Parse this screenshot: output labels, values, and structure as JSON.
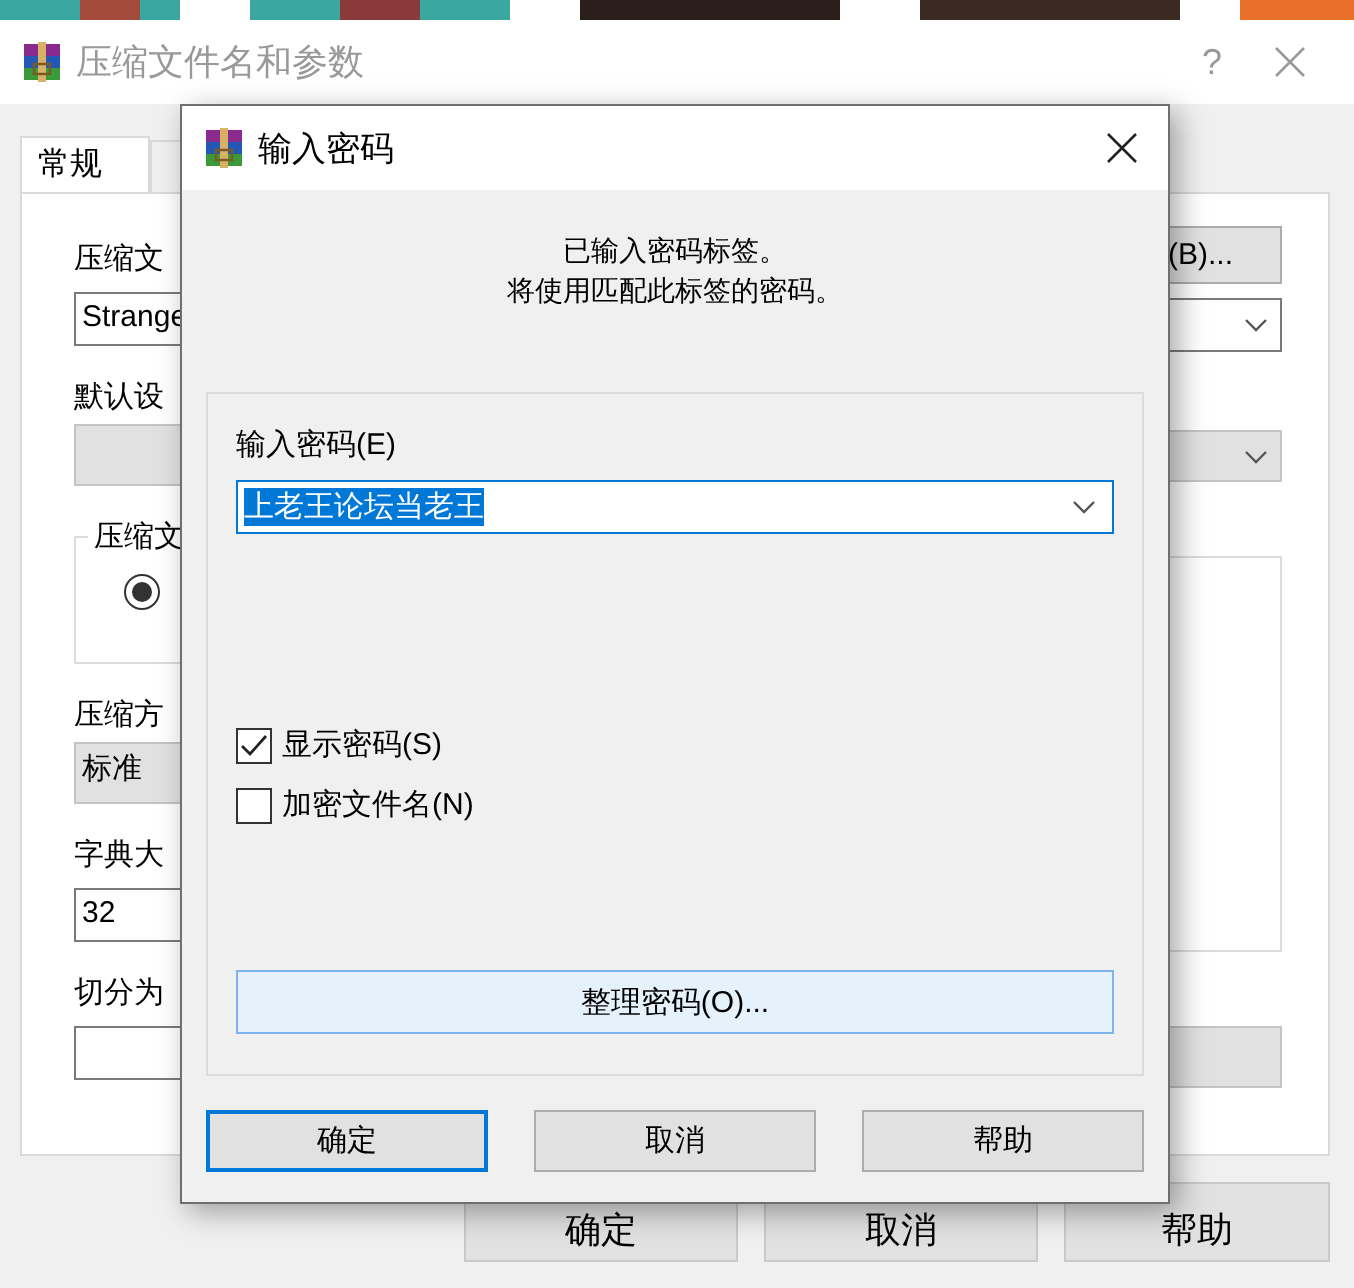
{
  "background_window": {
    "title": "压缩文件名和参数",
    "help": "?",
    "tabs": [
      {
        "label": "常规",
        "selected": true
      }
    ],
    "fields": [
      {
        "kind": "label",
        "text": "压缩文"
      },
      {
        "kind": "input",
        "value": "Strange"
      },
      {
        "kind": "label",
        "text": "默认设"
      },
      {
        "kind": "combo"
      },
      {
        "kind": "group",
        "legend": "压缩文",
        "radio_selected": true
      },
      {
        "kind": "label",
        "text": "压缩方"
      },
      {
        "kind": "combo",
        "value": "标准"
      },
      {
        "kind": "label",
        "text": "字典大"
      },
      {
        "kind": "input",
        "value": "32"
      },
      {
        "kind": "label",
        "text": "切分为"
      },
      {
        "kind": "input"
      }
    ],
    "browse_button": "(B)...",
    "buttons": [
      "确定",
      "取消",
      "帮助"
    ]
  },
  "password_dialog": {
    "title": "输入密码",
    "message": [
      "已输入密码标签。",
      "将使用匹配此标签的密码。"
    ],
    "password_label": "输入密码(E)",
    "password_value": "上老王论坛当老王",
    "options": [
      {
        "label": "显示密码(S)",
        "checked": true
      },
      {
        "label": "加密文件名(N)",
        "checked": false
      }
    ],
    "organize_button": "整理密码(O)...",
    "buttons": [
      {
        "label": "确定",
        "default": true
      },
      {
        "label": "取消",
        "default": false
      },
      {
        "label": "帮助",
        "default": false
      }
    ]
  }
}
